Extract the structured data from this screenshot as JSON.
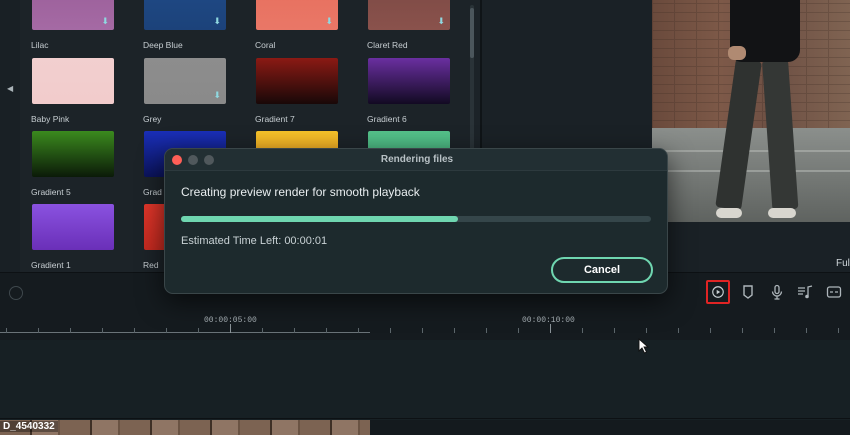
{
  "media_panel": {
    "tiles": [
      {
        "label": "Lilac",
        "color": "#9b5f9a",
        "gradient_end": "#a56aa4",
        "download": true
      },
      {
        "label": "Deep Blue",
        "color": "#1f4a86",
        "gradient_end": "#1c427a",
        "download": true
      },
      {
        "label": "Coral",
        "color": "#e8705e",
        "gradient_end": "#e97767",
        "download": true
      },
      {
        "label": "Claret Red",
        "color": "#7d4a45",
        "gradient_end": "#8a524c",
        "download": true
      },
      {
        "label": "Baby Pink",
        "color": "#f2cfcf",
        "gradient_end": "#f2cccc",
        "download": false
      },
      {
        "label": "Grey",
        "color": "#8d8d8d",
        "gradient_end": "#8a8a8a",
        "download": true
      },
      {
        "label": "Gradient 7",
        "color": "#8b1a14",
        "gradient_end": "#180808",
        "download": false
      },
      {
        "label": "Gradient 6",
        "color": "#6a2fa0",
        "gradient_end": "#120a22",
        "download": false
      },
      {
        "label": "Gradient 5",
        "color": "#3b8a1e",
        "gradient_end": "#0b1a08",
        "download": false
      },
      {
        "label": "Grad",
        "color": "#1a2fb8",
        "gradient_end": "#0b135a",
        "download": false
      },
      {
        "label": "",
        "color": "#f4c22a",
        "gradient_end": "#e68a1a",
        "download": false
      },
      {
        "label": "",
        "color": "#55c28a",
        "gradient_end": "#3aa070",
        "download": false
      },
      {
        "label": "Gradient 1",
        "color": "#8a52e0",
        "gradient_end": "#6a2fb8",
        "download": false
      },
      {
        "label": "Red",
        "color": "#e0362a",
        "gradient_end": "#c42a20",
        "download": false
      }
    ]
  },
  "player": {
    "full_label": "Ful"
  },
  "toolbar": {
    "icons": [
      "render-preview-icon",
      "marker-icon",
      "microphone-icon",
      "audio-music-icon",
      "caption-icon"
    ]
  },
  "timeline": {
    "time_labels": [
      "00:00:05:00",
      "00:00:10:00"
    ],
    "clip_label": "D_4540332"
  },
  "dialog": {
    "title": "Rendering files",
    "message": "Creating preview render for smooth playback",
    "progress_percent": 59,
    "eta": "Estimated Time Left: 00:00:01",
    "cancel_label": "Cancel"
  },
  "colors": {
    "accent": "#6fd6b0",
    "highlight_box": "#e02424",
    "close_button": "#ff5f57"
  }
}
